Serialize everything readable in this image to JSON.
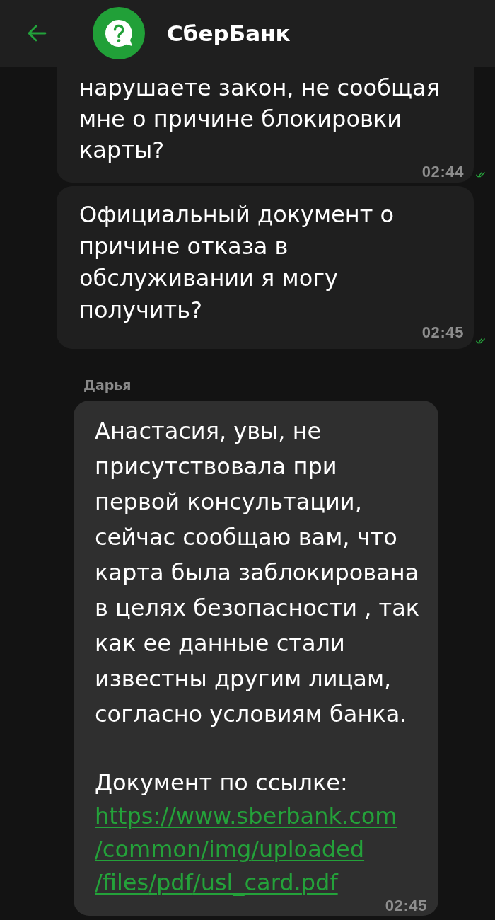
{
  "header": {
    "title": "СберБанк"
  },
  "messages": [
    {
      "kind": "outgoing",
      "text": "нарушаете закон, не сообщая мне о причине блокировки карты?",
      "time": "02:44",
      "read": true
    },
    {
      "kind": "outgoing",
      "text": "Официальный документ о причине отказа в обслуживании я могу получить?",
      "time": "02:45",
      "read": true
    },
    {
      "kind": "incoming",
      "sender": "Дарья",
      "text": "Анастасия, увы, не присутствовала при первой консультации, сейчас сообщаю вам, что карта была заблокирована в целях безопасности , так как ее данные стали известны другим лицам, согласно условиям банка.",
      "link_intro": "Документ по ссылке:",
      "link": "https://www.sberbank.com/common/img/uploaded/files/pdf/usl_card.pdf",
      "time": "02:45"
    }
  ]
}
